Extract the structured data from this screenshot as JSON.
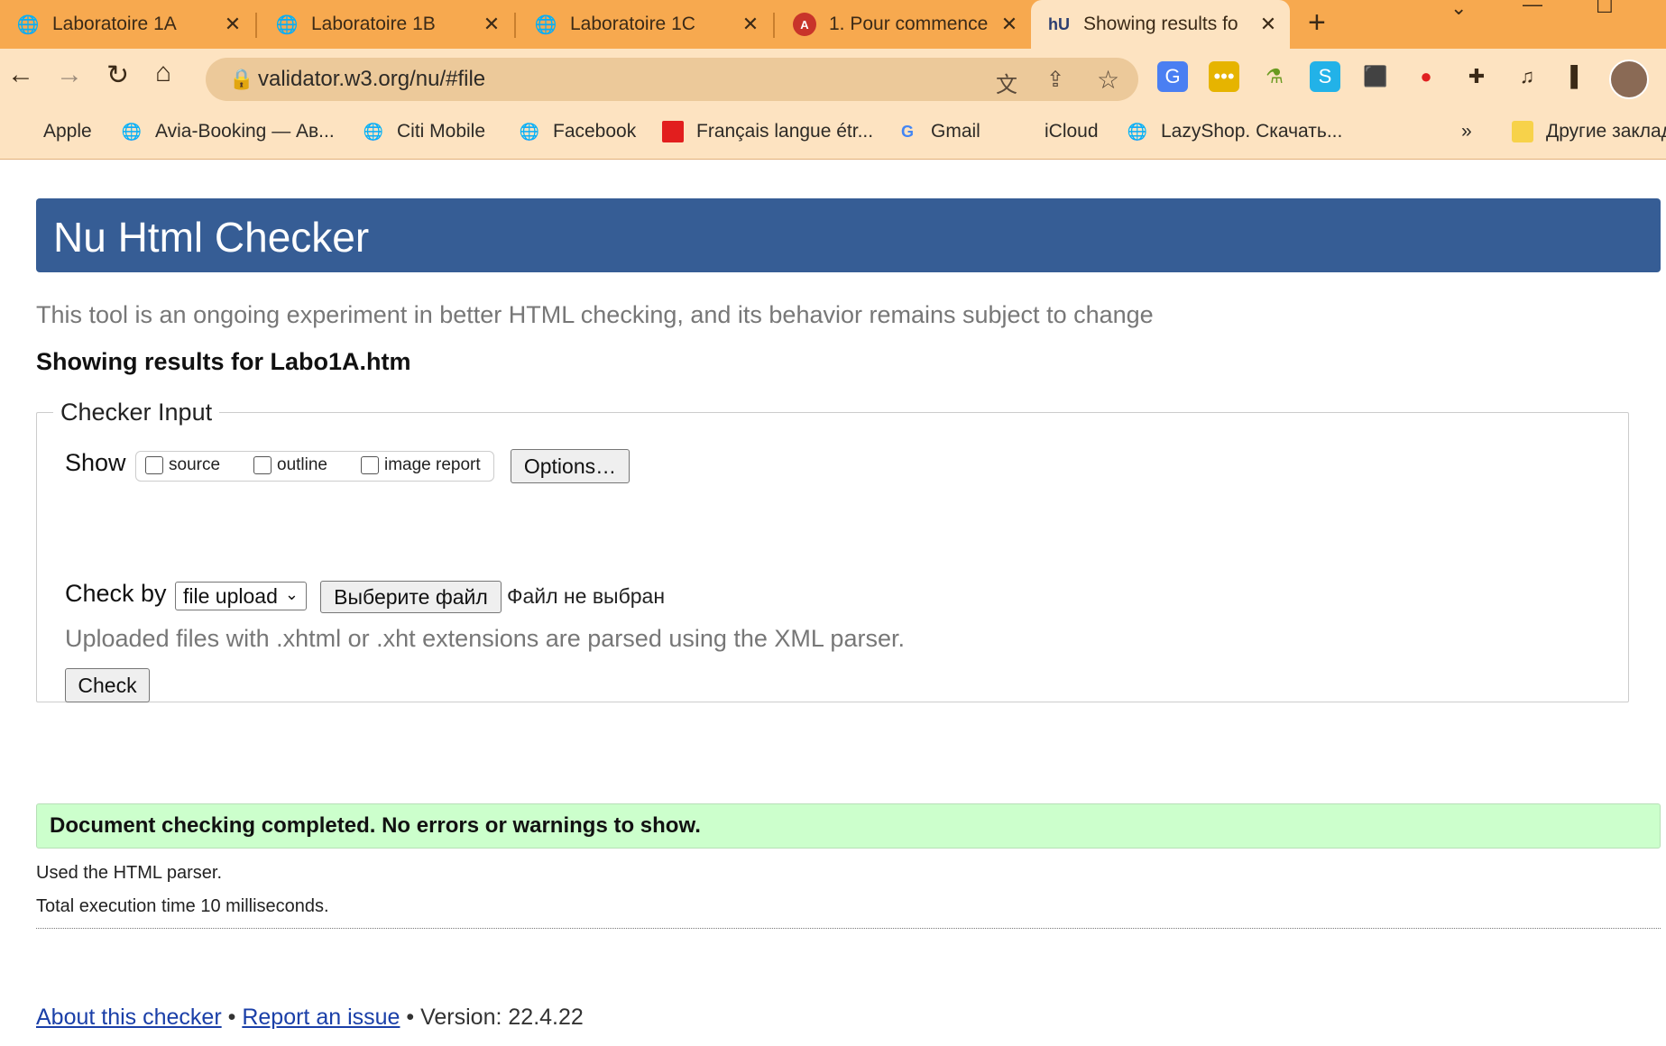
{
  "browser": {
    "tabs": [
      {
        "title": "Laboratoire 1A",
        "icon": "globe-icon",
        "active": false
      },
      {
        "title": "Laboratoire 1B",
        "icon": "globe-icon",
        "active": false
      },
      {
        "title": "Laboratoire 1C",
        "icon": "globe-icon",
        "active": false
      },
      {
        "title": "1. Pour commence",
        "icon": "app-icon",
        "active": false
      },
      {
        "title": "Showing results fo",
        "icon": "nu-icon",
        "active": true
      }
    ],
    "close_glyph": "✕",
    "new_tab_glyph": "+",
    "url": "validator.w3.org/nu/#file",
    "bookmarks": [
      {
        "label": "Apple"
      },
      {
        "label": "Avia-Booking — Ав..."
      },
      {
        "label": "Citi Mobile"
      },
      {
        "label": "Facebook"
      },
      {
        "label": "Français langue étr..."
      },
      {
        "label": "Gmail"
      },
      {
        "label": "iCloud"
      },
      {
        "label": "LazyShop. Скачать..."
      }
    ],
    "bookmarks_overflow": "»",
    "other_bookmarks": "Другие заклад"
  },
  "page": {
    "banner_title": "Nu Html Checker",
    "intro": "This tool is an ongoing experiment in better HTML checking, and its behavior remains subject to change",
    "results_for": "Showing results for Labo1A.htm",
    "checker_input": {
      "legend": "Checker Input",
      "show_label": "Show",
      "checkboxes": [
        "source",
        "outline",
        "image report"
      ],
      "options_button": "Options…",
      "check_by_label": "Check by",
      "select_value": "file upload",
      "choose_file_button": "Выберите файл",
      "no_file_text": "Файл не выбран",
      "upload_note": "Uploaded files with .xhtml or .xht extensions are parsed using the XML parser.",
      "check_button": "Check"
    },
    "success_message": "Document checking completed. No errors or warnings to show.",
    "parser_note": "Used the HTML parser.",
    "execution_time": "Total execution time 10 milliseconds.",
    "footer": {
      "about_link": "About this checker",
      "separator": "•",
      "report_link": "Report an issue",
      "version": "• Version: 22.4.22"
    }
  },
  "colors": {
    "tab_strip": "#f7a94f",
    "toolbar": "#fde3c1",
    "banner": "#365d95",
    "success_bg": "#ccffcc",
    "link": "#1a3fa8"
  }
}
